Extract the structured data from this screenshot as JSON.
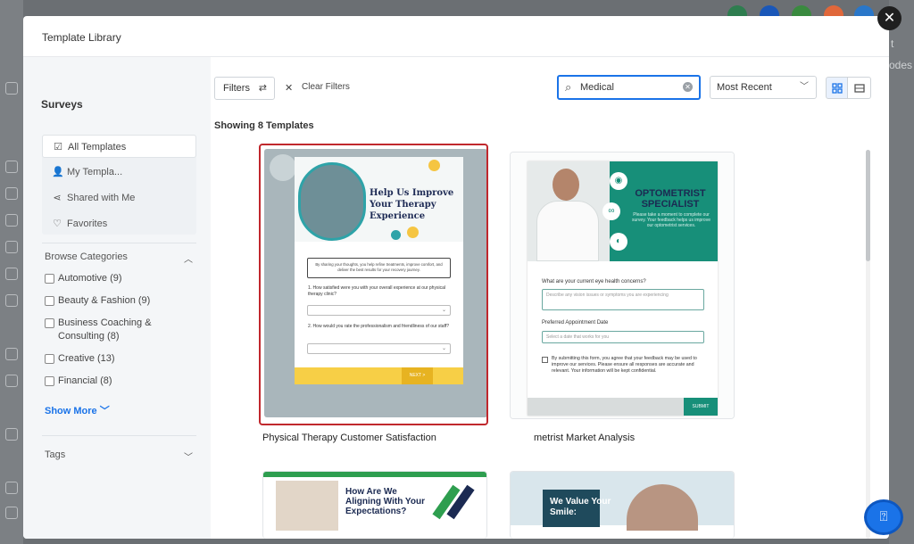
{
  "modal": {
    "title": "Template Library",
    "close_symbol": "✕"
  },
  "background": {
    "right_text_top": "t",
    "right_text_bottom": "odes"
  },
  "sidebar": {
    "heading": "Surveys",
    "items": [
      {
        "label": "All Templates",
        "icon": "check-square-icon",
        "active": true
      },
      {
        "label": "My Templa...",
        "icon": "user-icon",
        "active": false
      },
      {
        "label": "Shared with Me",
        "icon": "share-icon",
        "active": false
      },
      {
        "label": "Favorites",
        "icon": "heart-icon",
        "active": false
      }
    ],
    "browse_categories": {
      "label": "Browse Categories",
      "items": [
        {
          "label": "Automotive (9)"
        },
        {
          "label": "Beauty & Fashion (9)"
        },
        {
          "label": "Business Coaching & Consulting (8)"
        },
        {
          "label": "Creative (13)"
        },
        {
          "label": "Financial (8)"
        }
      ],
      "show_more": "Show More"
    },
    "tags_label": "Tags"
  },
  "toolbar": {
    "filters_label": "Filters",
    "clear_filters_label": "Clear Filters",
    "search_value": "Medical",
    "sort_value": "Most Recent"
  },
  "results": {
    "showing_text": "Showing 8 Templates"
  },
  "templates": [
    {
      "title": "Physical Therapy Customer Satisfaction",
      "selected": true,
      "preview": {
        "headline": "Help Us Improve Your Therapy Experience",
        "intro": "By sharing your thoughts, you help refine treatments, improve comfort, and deliver the best results for your recovery journey.",
        "q1": "1. How satisfied were you with your overall experience at our physical therapy clinic?",
        "q2": "2. How would you rate the professionalism and friendliness of our staff?",
        "button": "NEXT >",
        "accent": "#f7cf46"
      }
    },
    {
      "title": "metrist Market Analysis",
      "selected": false,
      "preview": {
        "headline": "OPTOMETRIST SPECIALIST",
        "sub": "Please take a moment to complete our survey. Your feedback helps us improve our optometrist services.",
        "field1_label": "What are your current eye health concerns?",
        "field1_placeholder": "Describe any vision issues or symptoms you are experiencing",
        "field2_label": "Preferred Appointment Date",
        "field2_placeholder": "Select a date that works for you",
        "consent": "By submitting this form, you agree that your feedback may be used to improve our services. Please ensure all responses are accurate and relevant. Your information will be kept confidential.",
        "button": "SUBMIT",
        "accent": "#178f79"
      }
    },
    {
      "preview": {
        "headline": "How Are We Aligning With Your Expectations?"
      }
    },
    {
      "preview": {
        "headline": "We Value Your Smile:"
      }
    }
  ]
}
